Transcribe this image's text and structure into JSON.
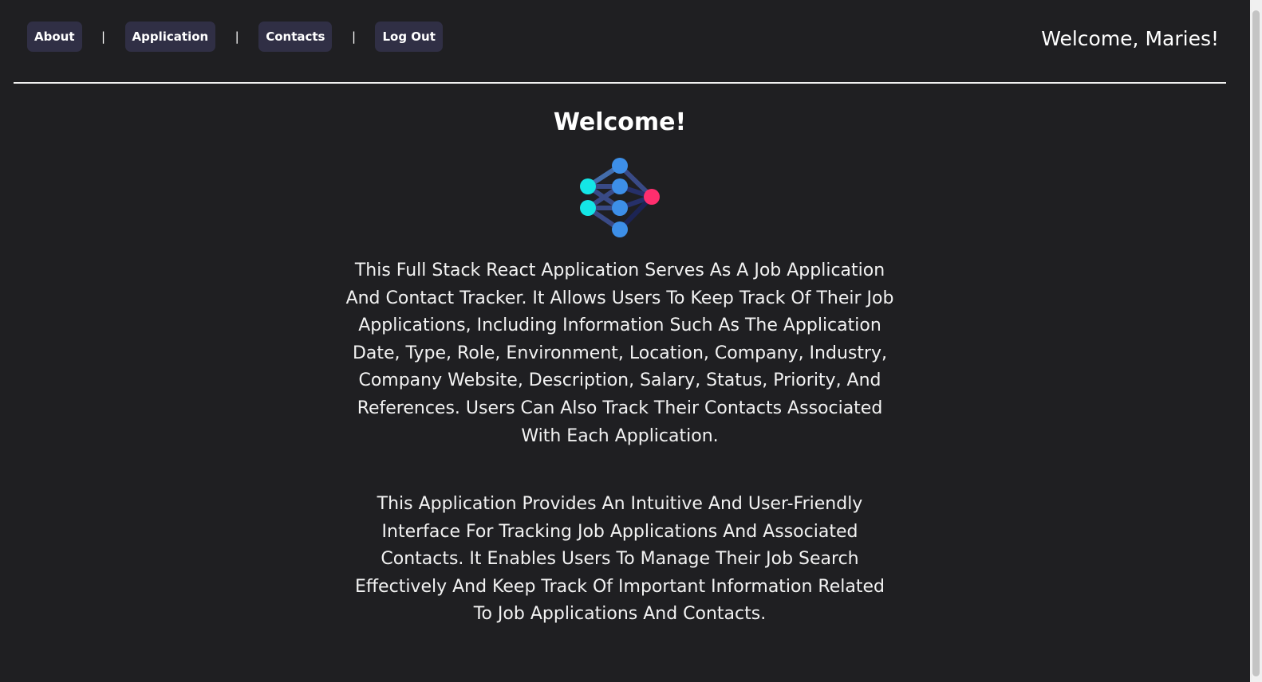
{
  "nav": {
    "items": [
      {
        "label": "About"
      },
      {
        "label": "Application"
      },
      {
        "label": "Contacts"
      },
      {
        "label": "Log Out"
      }
    ],
    "separator": "|"
  },
  "header": {
    "welcome_user": "Welcome, Maries!"
  },
  "main": {
    "title": "Welcome!",
    "logo_icon": "neural-network-icon",
    "paragraphs": [
      "This Full Stack React Application Serves As A Job Application And Contact Tracker. It Allows Users To Keep Track Of Their Job Applications, Including Information Such As The Application Date, Type, Role, Environment, Location, Company, Industry, Company Website, Description, Salary, Status, Priority, And References. Users Can Also Track Their Contacts Associated With Each Application.",
      "This Application Provides An Intuitive And User-Friendly Interface For Tracking Job Applications And Associated Contacts. It Enables Users To Manage Their Job Search Effectively And Keep Track Of Important Information Related To Job Applications And Contacts."
    ]
  },
  "colors": {
    "background": "#1f1f22",
    "nav_button": "#302f45",
    "logo_cyan": "#14e6e6",
    "logo_blue": "#3d8fe8",
    "logo_pink": "#ff2e6e"
  }
}
